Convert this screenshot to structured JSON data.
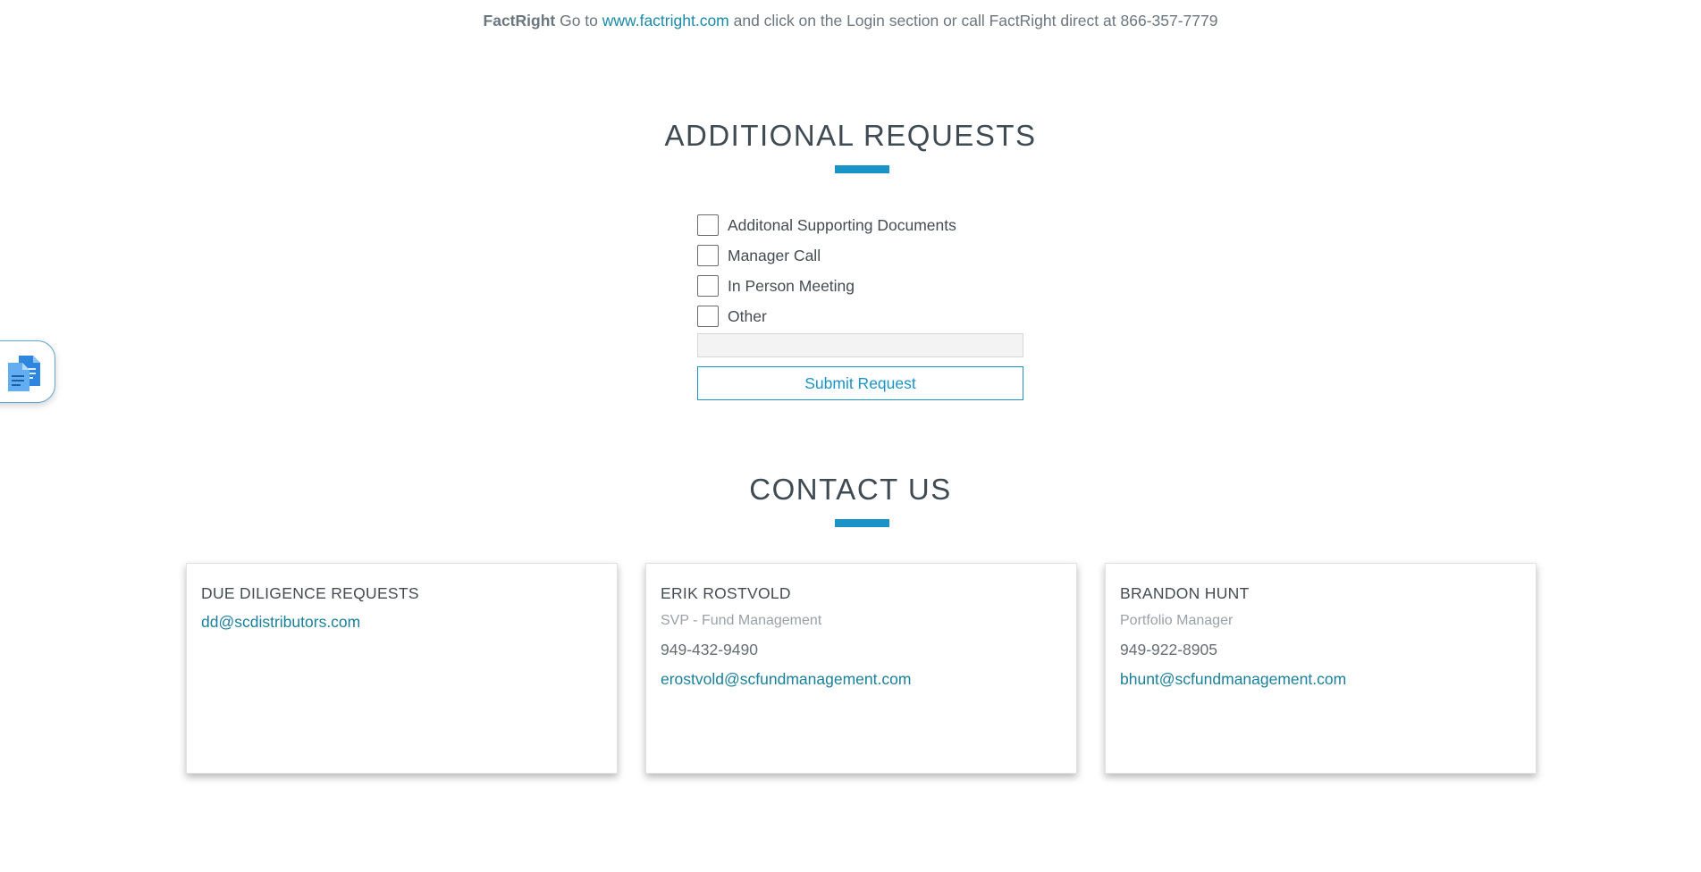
{
  "top": {
    "brand": "FactRight",
    "pre_link": " Go to ",
    "link": "www.factright.com",
    "post_link": " and click on the Login section or call FactRight direct at 866-357-7779"
  },
  "requests": {
    "title": "ADDITIONAL REQUESTS",
    "options": [
      "Additonal Supporting Documents",
      "Manager Call",
      "In Person Meeting",
      "Other"
    ],
    "other_value": "",
    "submit_label": "Submit Request"
  },
  "contact": {
    "title": "CONTACT US",
    "cards": [
      {
        "name": "DUE DILIGENCE REQUESTS",
        "email": "dd@scdistributors.com"
      },
      {
        "name": "ERIK ROSTVOLD",
        "role": "SVP - Fund Management",
        "phone": "949-432-9490",
        "email": "erostvold@scfundmanagement.com"
      },
      {
        "name": "BRANDON HUNT",
        "role": "Portfolio Manager",
        "phone": "949-922-8905",
        "email": "bhunt@scfundmanagement.com"
      }
    ]
  },
  "widget": {
    "icon": "documents-icon"
  },
  "colors": {
    "accent": "#1a93c6",
    "link": "#1a7f9a",
    "heading": "#3f4a52"
  }
}
